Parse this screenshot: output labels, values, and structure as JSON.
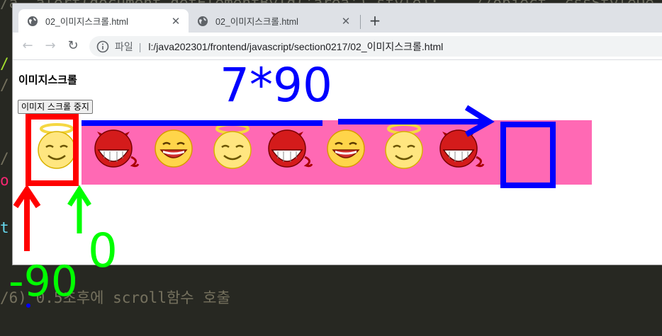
{
  "editor": {
    "top_line": "/a  alert(document.getElementById('area').style);    //object  cssStyleDe",
    "bottom_line": "/6) 0.5초후에 scroll함수 호출"
  },
  "browser": {
    "tabs": [
      {
        "title": "02_이미지스크롤.html",
        "active": true
      },
      {
        "title": "02_이미지스크롤.html",
        "active": false
      }
    ],
    "new_tab": "+",
    "omnibox": {
      "file_label": "파일",
      "url": "l:/java202301/frontend/javascript/section0217/02_이미지스크롤.html"
    }
  },
  "page": {
    "title": "이미지스크롤",
    "stop_button": "이미지 스크롤 중지",
    "images": [
      "angel",
      "devil",
      "grin",
      "angel",
      "devil",
      "grin",
      "angel",
      "devil"
    ]
  },
  "annotations": {
    "blue_label": "7*90",
    "green_label": "0",
    "red_label": "-90"
  },
  "colors": {
    "pink": "#ff69b4",
    "red": "#ff0000",
    "blue": "#0000ff",
    "green": "#00ff00"
  }
}
